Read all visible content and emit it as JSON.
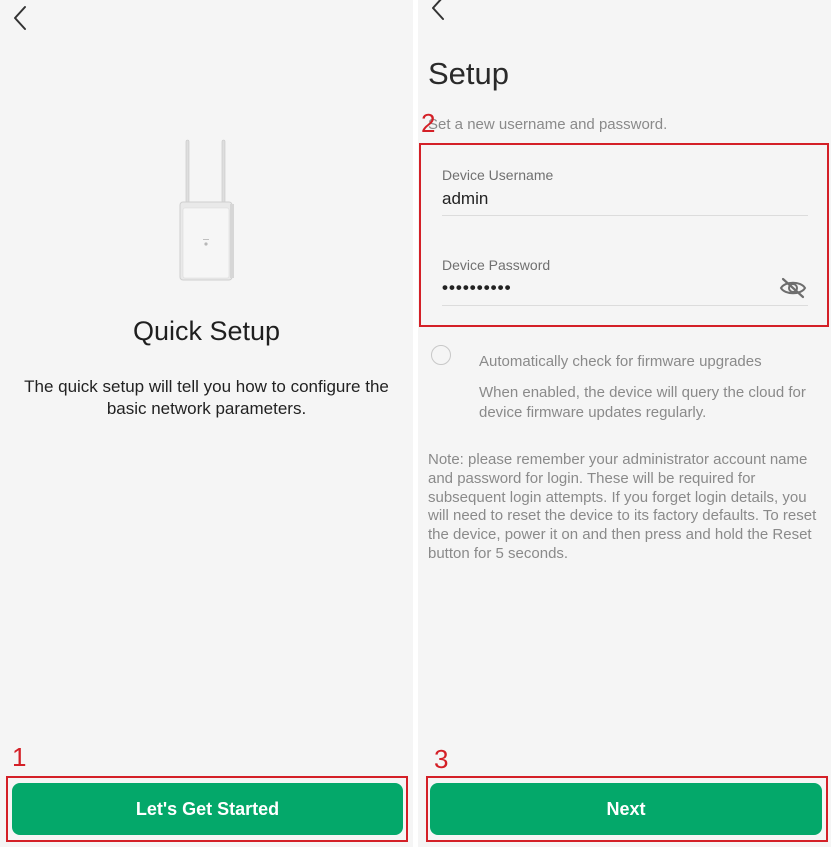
{
  "left_screen": {
    "back_icon": "chevron-left",
    "device_image": "outdoor-access-point",
    "title": "Quick Setup",
    "description": "The quick setup will tell you how to configure the basic network parameters.",
    "start_button_label": "Let's Get Started"
  },
  "right_screen": {
    "back_icon": "chevron-left",
    "title": "Setup",
    "subtitle": "Set a new username and password.",
    "username_label": "Device Username",
    "username_value": "admin",
    "password_label": "Device Password",
    "password_value": "••••••••••",
    "password_visibility_icon": "eye-off",
    "auto_check_label": "Automatically check for firmware upgrades",
    "auto_check_checked": false,
    "auto_check_help": "When enabled, the device will query the cloud for device firmware updates regularly.",
    "note": "Note: please remember your administrator account name and password for login. These will be required for subsequent login attempts. If you forget login details, you will need to reset the device to its factory defaults. To reset the device, power it on and then press and hold the Reset button for 5 seconds.",
    "next_button_label": "Next"
  },
  "annotations": [
    "1",
    "2",
    "3"
  ],
  "colors": {
    "primary_green": "#04a86a",
    "annotation_red": "#d42027",
    "background": "#f5f5f5"
  }
}
